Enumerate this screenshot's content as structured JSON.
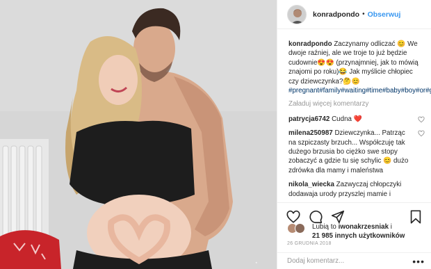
{
  "post": {
    "username": "konradpondo",
    "follow_label": "Obserwuj",
    "separator": "•"
  },
  "caption": {
    "text": "Zaczynamy odliczać 😊 We dwoje raźniej, ale we troje to już będzie cudownie😍😍 (przynajmniej, jak to mówią znajomi po roku)😂 Jak myślicie chłopiec czy dziewczynka?🤔😊",
    "hashtags": "#pregnant#family#waiting#time#baby#boy#or#girl#amazing#cant#wait#parets#life#healt#body#hug#love#aroundtheworld"
  },
  "load_more_label": "Załaduj więcej komentarzy",
  "comments": [
    {
      "user": "patrycja6742",
      "text": "Cudna ❤️"
    },
    {
      "user": "milena250987",
      "text": "Dziewczynka... Patrząc na szpiczasty brzuch... Współczuję tak dużego brzusia bo ciężko swe stopy zobaczyć a gdzie tu się schylic 😊 dużo zdrówka dla mamy i maleństwa"
    },
    {
      "user": "nikola_wiecka",
      "text": "Zazwyczaj chłopczyki dodawaja urody przyszlej mamie i"
    }
  ],
  "likes": {
    "prefix": "Lubią to",
    "liker": "iwonakrzesniak",
    "conj": "i",
    "others": "21 985 innych użytkowników"
  },
  "date": "26 GRUDNIA 2018",
  "add_comment": {
    "placeholder": "Dodaj komentarz...",
    "more_label": "•••"
  },
  "icons": {
    "like": "heart-outline-icon",
    "comment": "comment-bubble-icon",
    "share": "share-arrow-icon",
    "save": "bookmark-icon"
  },
  "colors": {
    "follow": "#3897f0",
    "hashtag": "#003569",
    "muted": "#999999",
    "heart": "#ed4956"
  }
}
